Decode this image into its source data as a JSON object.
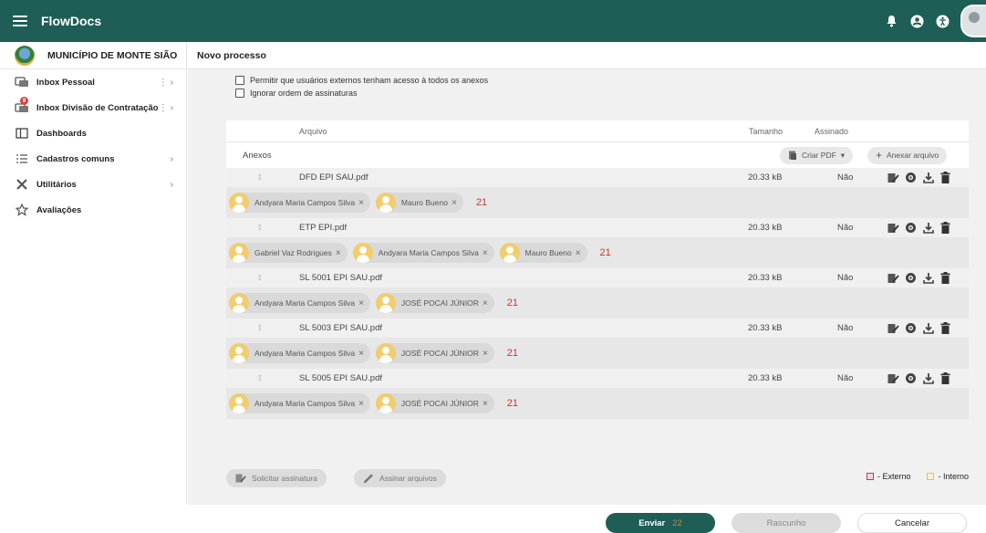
{
  "app": {
    "title": "FlowDocs"
  },
  "topbar": {
    "icons": [
      "bell-icon",
      "account-icon",
      "accessibility-icon"
    ]
  },
  "sidebar": {
    "municipality": "MUNICÍPIO DE MONTE SIÃO",
    "items": [
      {
        "label": "Inbox Pessoal",
        "icon": "inbox-icon",
        "extra": "⋮ ›"
      },
      {
        "label": "Inbox Divisão de Contratação",
        "icon": "inbox-group-icon",
        "badge": "9",
        "extra": "⋮ ›"
      },
      {
        "label": "Dashboards",
        "icon": "dashboard-icon"
      },
      {
        "label": "Cadastros comuns",
        "icon": "list-icon",
        "extra": "›"
      },
      {
        "label": "Utilitários",
        "icon": "tools-icon",
        "extra": "›"
      },
      {
        "label": "Avaliações",
        "icon": "star-icon"
      }
    ]
  },
  "header": {
    "title": "Novo processo"
  },
  "options": {
    "external_access": "Permitir que usuários externos tenham acesso à todos os anexos",
    "ignore_order": "Ignorar ordem de assinaturas"
  },
  "table": {
    "columns": {
      "arquivo": "Arquivo",
      "tamanho": "Tamanho",
      "assinado": "Assinado"
    },
    "anexos_label": "Anexos",
    "criar_pdf": "Criar PDF",
    "anexar_arquivo": "Anexar arquivo",
    "files": [
      {
        "name": "DFD EPI SAU.pdf",
        "size": "20.33 kB",
        "signed": "Não"
      },
      {
        "name": "ETP EPI.pdf",
        "size": "20.33 kB",
        "signed": "Não"
      },
      {
        "name": "SL 5001 EPI SAU.pdf",
        "size": "20.33 kB",
        "signed": "Não"
      },
      {
        "name": "SL 5003 EPI SAU.pdf",
        "size": "20.33 kB",
        "signed": "Não"
      },
      {
        "name": "SL 5005 EPI SAU.pdf",
        "size": "20.33 kB",
        "signed": "Não"
      }
    ],
    "signers": [
      [
        "Andyara Maria Campos Silva",
        "Mauro Bueno"
      ],
      [
        "Gabriel Vaz Rodrigues",
        "Andyara Maria Campos Silva",
        "Mauro Bueno"
      ],
      [
        "Andyara Maria Campos Silva",
        "JOSÉ POCAI JÚNIOR"
      ],
      [
        "Andyara Maria Campos Silva",
        "JOSÉ POCAI JÚNIOR"
      ],
      [
        "Andyara Maria Campos Silva",
        "JOSÉ POCAI JÚNIOR"
      ]
    ],
    "row_marker": "21"
  },
  "actions": {
    "solicitar_assinatura": "Solicitar assinatura",
    "assinar_arquivos": "Assinar arquivos"
  },
  "legend": {
    "externo": "- Externo",
    "interno": "- Interno",
    "externo_color": "#c0405a",
    "interno_color": "#e0c060"
  },
  "footer": {
    "enviar": "Enviar",
    "enviar_marker": "22",
    "rascunho": "Rascunho",
    "cancelar": "Cancelar"
  },
  "colors": {
    "primary": "#1e5e57"
  }
}
